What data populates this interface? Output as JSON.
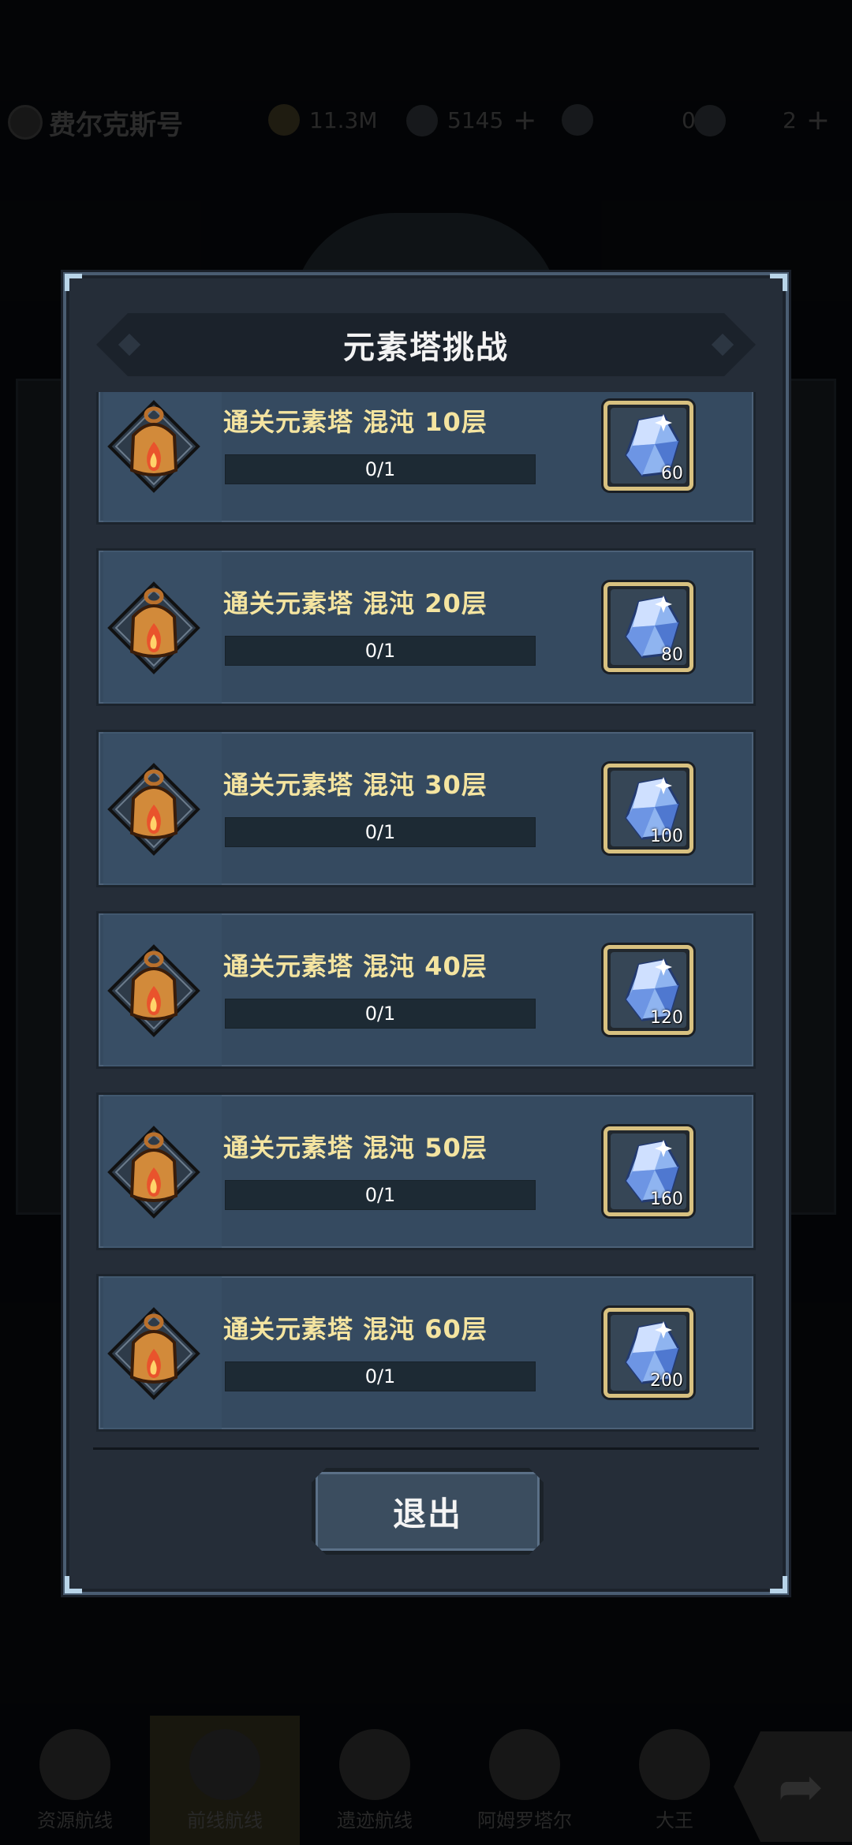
{
  "background": {
    "ship_name": "费尔克斯号",
    "resources": [
      {
        "icon": "coin-icon",
        "value": "11.3M",
        "plus": ""
      },
      {
        "icon": "feather-icon",
        "value": "5145",
        "plus": "+"
      },
      {
        "icon": "chip-icon",
        "value": "0",
        "plus": ""
      },
      {
        "icon": "fuel-icon",
        "value": "2",
        "plus": "+"
      }
    ],
    "nav": [
      {
        "label": "资源航线"
      },
      {
        "label": "前线航线"
      },
      {
        "label": "遗迹航线"
      },
      {
        "label": "阿姆罗塔尔"
      },
      {
        "label": "大王"
      }
    ],
    "arrow_glyph": "➦"
  },
  "modal": {
    "title": "元素塔挑战",
    "tasks": [
      {
        "title": "通关元素塔 混沌 10层",
        "progress_text": "0/1",
        "progress": 0.0,
        "reward_icon": "blue-crystal-icon",
        "reward_count": "60"
      },
      {
        "title": "通关元素塔 混沌 20层",
        "progress_text": "0/1",
        "progress": 0.0,
        "reward_icon": "blue-crystal-icon",
        "reward_count": "80"
      },
      {
        "title": "通关元素塔 混沌 30层",
        "progress_text": "0/1",
        "progress": 0.0,
        "reward_icon": "blue-crystal-icon",
        "reward_count": "100"
      },
      {
        "title": "通关元素塔 混沌 40层",
        "progress_text": "0/1",
        "progress": 0.0,
        "reward_icon": "blue-crystal-icon",
        "reward_count": "120"
      },
      {
        "title": "通关元素塔 混沌 50层",
        "progress_text": "0/1",
        "progress": 0.0,
        "reward_icon": "blue-crystal-icon",
        "reward_count": "160"
      },
      {
        "title": "通关元素塔 混沌 60层",
        "progress_text": "0/1",
        "progress": 0.0,
        "reward_icon": "blue-crystal-icon",
        "reward_count": "200"
      }
    ],
    "exit_label": "退出"
  },
  "colors": {
    "task_title": "#f4e4a0",
    "card_bg": "#354a60",
    "reward_border": "#d8c180",
    "modal_border": "#4a5d72"
  }
}
